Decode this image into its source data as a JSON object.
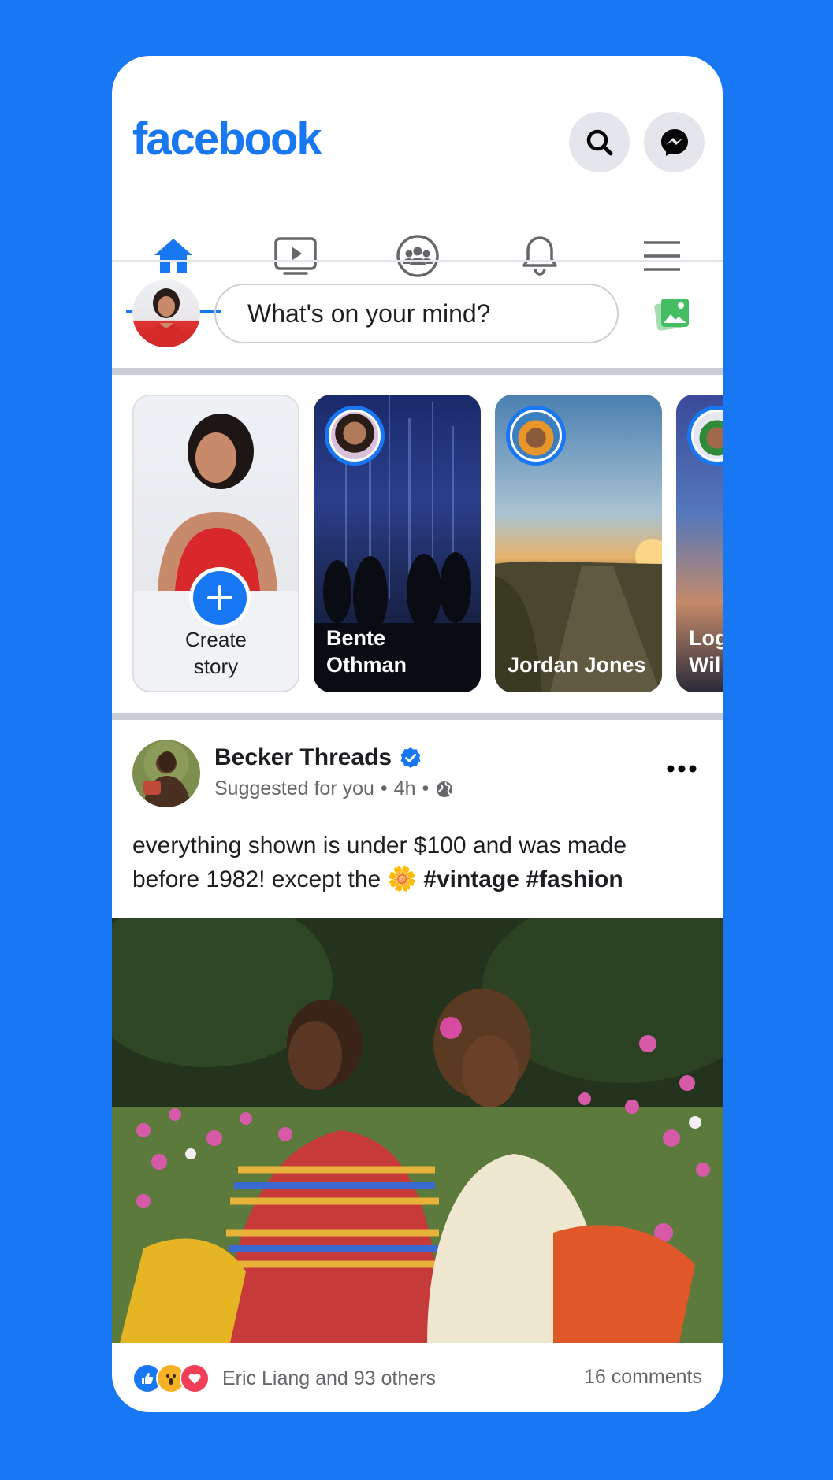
{
  "header": {
    "logo": "facebook",
    "search_icon": "search-icon",
    "messenger_icon": "messenger-icon"
  },
  "tabs": [
    {
      "name": "home",
      "icon": "home-icon",
      "active": true
    },
    {
      "name": "watch",
      "icon": "video-icon"
    },
    {
      "name": "groups",
      "icon": "groups-icon"
    },
    {
      "name": "notifications",
      "icon": "bell-icon"
    },
    {
      "name": "menu",
      "icon": "menu-icon"
    }
  ],
  "composer": {
    "placeholder": "What's on your mind?",
    "photo_icon": "photo-icon"
  },
  "stories": {
    "create_label": "Create\nstory",
    "items": [
      {
        "name": "Bente\nOthman"
      },
      {
        "name": "Jordan Jones"
      },
      {
        "name": "Log\nWil"
      }
    ]
  },
  "post": {
    "author": "Becker Threads",
    "verified": true,
    "suggested": "Suggested for you",
    "time": "4h",
    "privacy_icon": "globe-icon",
    "text_part1": "everything shown is under $100 and was made before 1982! except the",
    "emoji": "🌼",
    "hashtag1": "#vintage",
    "hashtag2": "#fashion",
    "reactions": [
      "like",
      "wow",
      "love"
    ],
    "likes": "Eric Liang and 93 others",
    "comments": "16 comments"
  },
  "colors": {
    "brand": "#1877F2",
    "background": "#1877F2",
    "text_secondary": "#65676b"
  }
}
